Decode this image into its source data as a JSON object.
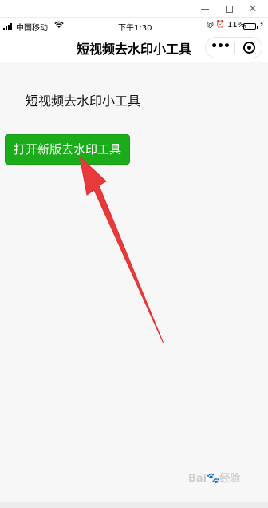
{
  "window": {
    "minimize_glyph": "",
    "maximize_glyph": "",
    "close_glyph": "✕"
  },
  "status_bar": {
    "carrier": "中国移动",
    "wifi_icon": "wifi-icon",
    "time": "下午1:30",
    "icons_text": "@ ⏰",
    "battery": "11%",
    "battery_level_percent": 11,
    "charge_glyph": "⚡"
  },
  "nav": {
    "title": "短视频去水印小工具",
    "more_glyph": "•••"
  },
  "main": {
    "heading": "短视频去水印小工具",
    "open_button_label": "打开新版去水印工具"
  },
  "watermark": {
    "text": "Bai🐾经验"
  },
  "colors": {
    "button_green": "#1aad19",
    "arrow_red": "#e83a3a",
    "battery_red": "#ff3b30"
  }
}
